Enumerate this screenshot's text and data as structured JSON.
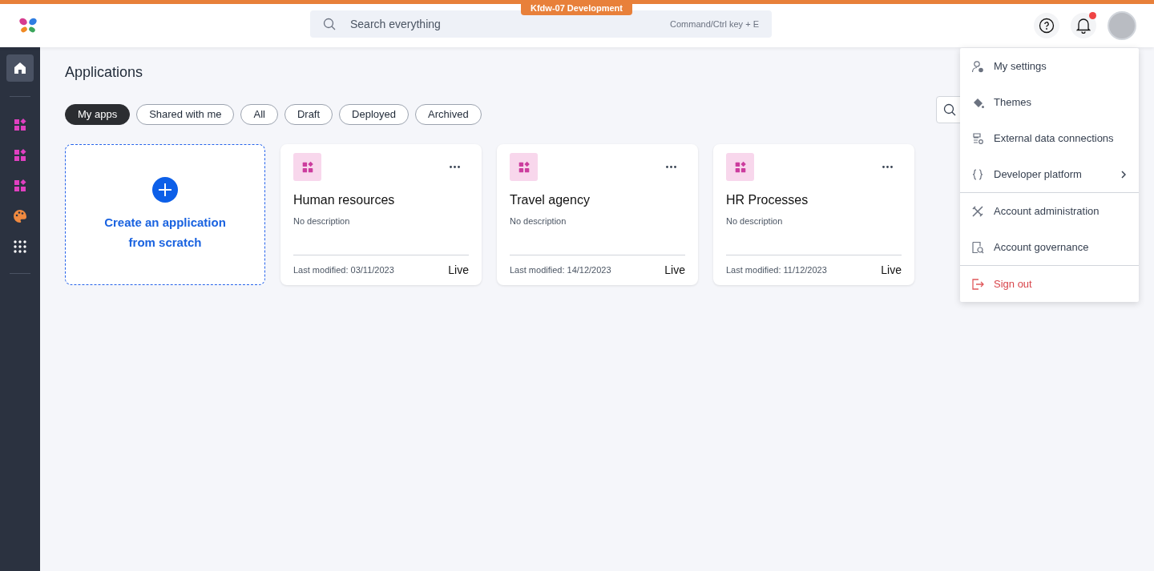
{
  "environment_badge": "Kfdw-07 Development",
  "search": {
    "placeholder": "Search everything",
    "shortcut": "Command/Ctrl key + E"
  },
  "notifications": {
    "unread": true
  },
  "sidebar": {
    "items": [
      {
        "kind": "home",
        "selected": true
      },
      {
        "kind": "app",
        "selected": false
      },
      {
        "kind": "app",
        "selected": false
      },
      {
        "kind": "app",
        "selected": false
      },
      {
        "kind": "palette",
        "selected": false
      },
      {
        "kind": "grid",
        "selected": false
      }
    ]
  },
  "page_title": "Applications",
  "filters": [
    {
      "label": "My apps",
      "selected": true
    },
    {
      "label": "Shared with me",
      "selected": false
    },
    {
      "label": "All",
      "selected": false
    },
    {
      "label": "Draft",
      "selected": false
    },
    {
      "label": "Deployed",
      "selected": false
    },
    {
      "label": "Archived",
      "selected": false
    }
  ],
  "create_card": {
    "label": "Create an application from scratch"
  },
  "apps": [
    {
      "name": "Human resources",
      "description": "No description",
      "modified": "Last modified: 03/11/2023",
      "status": "Live"
    },
    {
      "name": "Travel agency",
      "description": "No description",
      "modified": "Last modified: 14/12/2023",
      "status": "Live"
    },
    {
      "name": "HR Processes",
      "description": "No description",
      "modified": "Last modified: 11/12/2023",
      "status": "Live"
    }
  ],
  "user_menu": {
    "groups": [
      [
        {
          "kind": "settings",
          "label": "My settings",
          "submenu": false,
          "danger": false
        },
        {
          "kind": "themes",
          "label": "Themes",
          "submenu": false,
          "danger": false
        },
        {
          "kind": "data",
          "label": "External data connections",
          "submenu": false,
          "danger": false
        },
        {
          "kind": "developer",
          "label": "Developer platform",
          "submenu": true,
          "danger": false
        }
      ],
      [
        {
          "kind": "admin",
          "label": "Account administration",
          "submenu": false,
          "danger": false
        },
        {
          "kind": "governance",
          "label": "Account governance",
          "submenu": false,
          "danger": false
        }
      ],
      [
        {
          "kind": "signout",
          "label": "Sign out",
          "submenu": false,
          "danger": true
        }
      ]
    ]
  }
}
